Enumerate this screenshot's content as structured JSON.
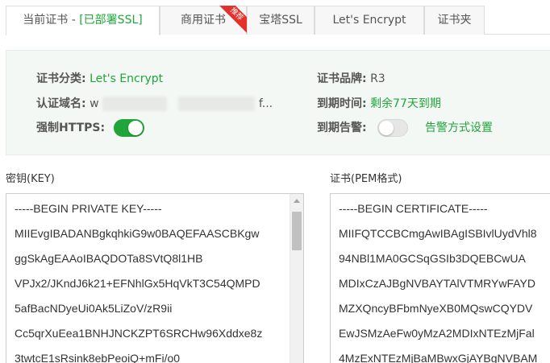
{
  "tabs": [
    {
      "label": "当前证书 - ",
      "hint": "[已部署SSL]",
      "active": true
    },
    {
      "label": "商用证书",
      "badge": "推荐"
    },
    {
      "label": "宝塔SSL"
    },
    {
      "label": "Let's Encrypt"
    },
    {
      "label": "证书夹"
    }
  ],
  "info": {
    "category_label": "证书分类:",
    "category_value": "Let's Encrypt",
    "brand_label": "证书品牌:",
    "brand_value": "R3",
    "domain_label": "认证域名:",
    "domain_prefix": "w",
    "domain_suffix": "f...",
    "expire_label": "到期时间:",
    "expire_value": "剩余77天到期",
    "https_label": "强制HTTPS:",
    "https_enabled": true,
    "alert_label": "到期告警:",
    "alert_enabled": false,
    "alert_link": "告警方式设置"
  },
  "key": {
    "label": "密钥(KEY)",
    "lines": [
      "-----BEGIN PRIVATE KEY-----",
      "MIIEvgIBADANBgkqhkiG9w0BAQEFAASCBKgw",
      "ggSkAgEAAoIBAQDOTa8SVtQ8l1HB",
      "VPJx2/JKndJ6k21+EFNhlGx5HqVkT3C54QMPD",
      "5afBacNDyeUi0Ak5LiZoV/zR9ii",
      "Cc5qrXuEea1BNHJNCKZPT6SRCHw96Xddxe8z",
      "3twtcE1sRsink8ebPeoiQ+mFi/o0"
    ]
  },
  "cert": {
    "label": "证书(PEM格式)",
    "lines": [
      "-----BEGIN CERTIFICATE-----",
      "MIIFQTCCBCmgAwIBAgISBIvlUydVhl8",
      "94NBl1MA0GCSqGSIb3DQEBCwUA",
      "MDIxCzAJBgNVBAYTAlVTMRYwFAYD",
      "MZXQncyBFbmNyeXB0MQswCQYDV",
      "EwJSMzAeFw0yMzA2MDIxNTEzMjFal",
      "4MzExNTEzMjBaMBwxGjAYBgNVBAM"
    ]
  },
  "colors": {
    "accent": "#20a53a",
    "ribbon": "#e3312b"
  }
}
